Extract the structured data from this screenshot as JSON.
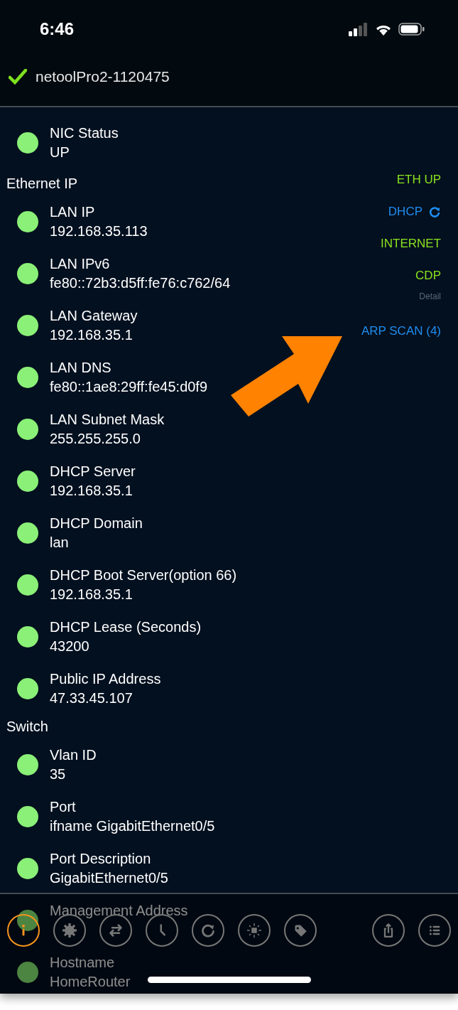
{
  "status_bar": {
    "time": "6:46"
  },
  "header": {
    "connected": true,
    "title": "netoolPro2-1120475"
  },
  "list": [
    {
      "kind": "row",
      "label": "NIC Status",
      "value": "UP"
    },
    {
      "kind": "section",
      "label": "Ethernet IP"
    },
    {
      "kind": "row",
      "label": "LAN IP",
      "value": "192.168.35.113"
    },
    {
      "kind": "row",
      "label": "LAN IPv6",
      "value": "fe80::72b3:d5ff:fe76:c762/64"
    },
    {
      "kind": "row",
      "label": "LAN Gateway",
      "value": "192.168.35.1"
    },
    {
      "kind": "row",
      "label": "LAN DNS",
      "value": "fe80::1ae8:29ff:fe45:d0f9"
    },
    {
      "kind": "row",
      "label": "LAN Subnet Mask",
      "value": "255.255.255.0"
    },
    {
      "kind": "row",
      "label": "DHCP Server",
      "value": "192.168.35.1"
    },
    {
      "kind": "row",
      "label": "DHCP Domain",
      "value": "lan"
    },
    {
      "kind": "row",
      "label": "DHCP Boot Server(option 66)",
      "value": "192.168.35.1"
    },
    {
      "kind": "row",
      "label": "DHCP Lease (Seconds)",
      "value": "43200"
    },
    {
      "kind": "row",
      "label": "Public IP Address",
      "value": "47.33.45.107"
    },
    {
      "kind": "section",
      "label": "Switch"
    },
    {
      "kind": "row",
      "label": "Vlan ID",
      "value": "35"
    },
    {
      "kind": "row",
      "label": "Port",
      "value": "ifname GigabitEthernet0/5"
    },
    {
      "kind": "row",
      "label": "Port Description",
      "value": "GigabitEthernet0/5"
    },
    {
      "kind": "row",
      "label": "Management Address"
    },
    {
      "kind": "row",
      "label": "Hostname",
      "value": "HomeRouter"
    }
  ],
  "indicators": [
    {
      "kind": "status",
      "label": "ETH UP"
    },
    {
      "kind": "link",
      "label": "DHCP",
      "refresh": true
    },
    {
      "kind": "status",
      "label": "INTERNET"
    },
    {
      "kind": "status",
      "label": "CDP"
    },
    {
      "kind": "hint",
      "label": "Detail"
    },
    {
      "kind": "link",
      "label": "ARP SCAN (4)"
    }
  ],
  "toolbar": [
    {
      "kind": "info",
      "selected": true
    },
    {
      "kind": "gear",
      "selected": false
    },
    {
      "kind": "swap",
      "selected": false
    },
    {
      "kind": "clock",
      "selected": false
    },
    {
      "kind": "refresh",
      "selected": false
    },
    {
      "kind": "light",
      "selected": false
    },
    {
      "kind": "tag",
      "selected": false
    },
    {
      "kind": "spacer"
    },
    {
      "kind": "share",
      "selected": false
    },
    {
      "kind": "list",
      "selected": false
    }
  ]
}
